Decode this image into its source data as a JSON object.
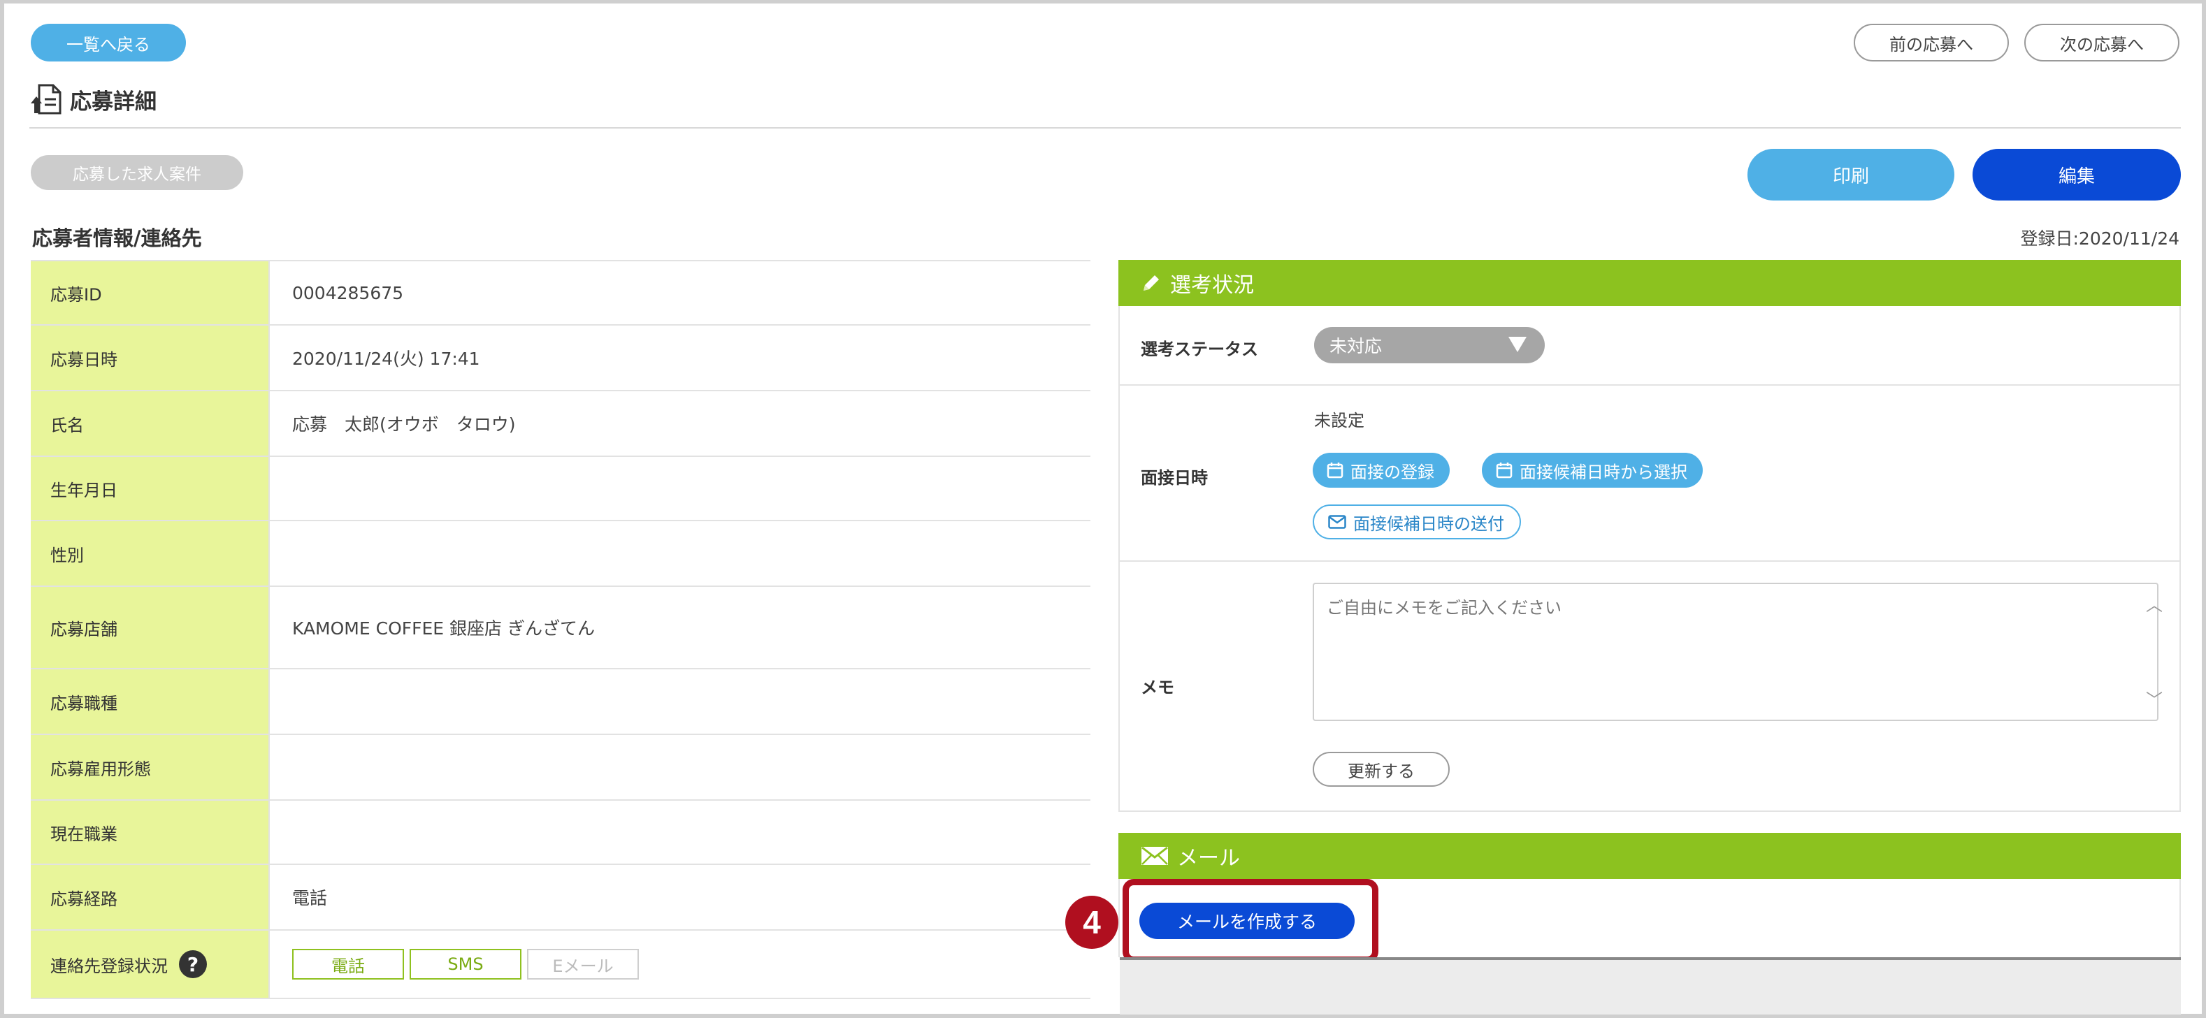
{
  "header": {
    "back_label": "一覧へ戻る",
    "prev_label": "前の応募へ",
    "next_label": "次の応募へ",
    "title": "応募詳細"
  },
  "toolbar": {
    "job_label": "応募した求人案件",
    "print_label": "印刷",
    "edit_label": "編集"
  },
  "applicant": {
    "section_title": "応募者情報/連絡先",
    "registered": "登録日:2020/11/24",
    "rows": [
      {
        "label": "応募ID",
        "value": "0004285675"
      },
      {
        "label": "応募日時",
        "value": "2020/11/24(火) 17:41"
      },
      {
        "label": "氏名",
        "value": "応募　太郎(オウボ　タロウ)"
      },
      {
        "label": "生年月日",
        "value": ""
      },
      {
        "label": "性別",
        "value": ""
      },
      {
        "label": "応募店舗",
        "value": "KAMOME COFFEE 銀座店 ぎんざてん"
      },
      {
        "label": "応募職種",
        "value": ""
      },
      {
        "label": "応募雇用形態",
        "value": ""
      },
      {
        "label": "現在職業",
        "value": ""
      },
      {
        "label": "応募経路",
        "value": "電話"
      }
    ],
    "contact_label": "連絡先登録状況",
    "contact_methods": [
      "電話",
      "SMS",
      "Eメール"
    ]
  },
  "selection": {
    "header": "選考状況",
    "status_label": "選考ステータス",
    "status_value": "未対応",
    "interview_label": "面接日時",
    "interview_value": "未設定",
    "register_interview": "面接の登録",
    "select_candidate": "面接候補日時から選択",
    "send_candidate": "面接候補日時の送付",
    "memo_label": "メモ",
    "memo_placeholder": "ご自由にメモをご記入ください",
    "update_label": "更新する"
  },
  "mail": {
    "header": "メール",
    "create_label": "メールを作成する",
    "step_number": "4"
  },
  "colors": {
    "accent_blue": "#4fb0e6",
    "primary_blue": "#0a4ad6",
    "green": "#8cc21f",
    "label_bg": "#e8f59a",
    "highlight_red": "#b00f1f"
  }
}
